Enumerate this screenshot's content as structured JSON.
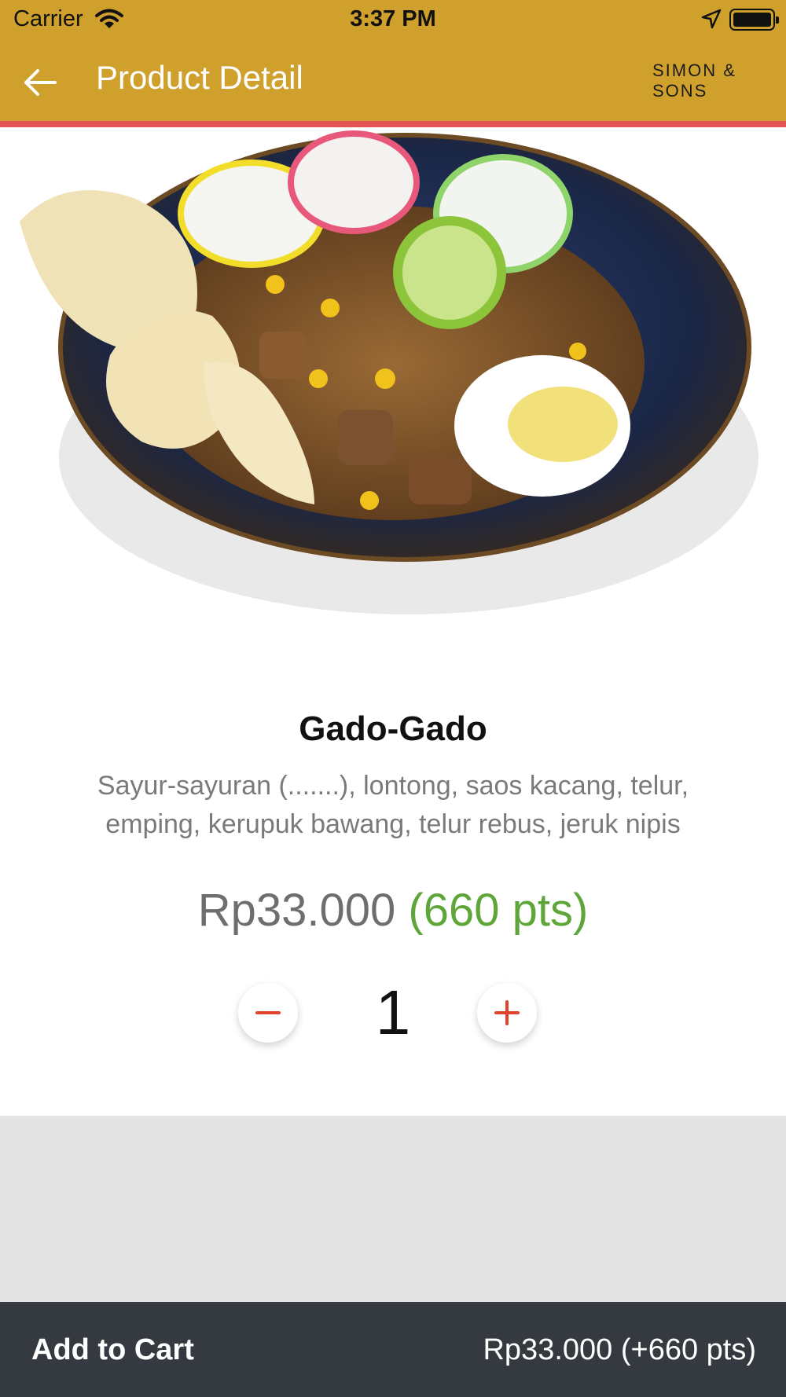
{
  "status_bar": {
    "carrier": "Carrier",
    "time": "3:37 PM",
    "icons": [
      "wifi-icon",
      "location-arrow-icon",
      "battery-icon"
    ]
  },
  "header": {
    "title": "Product Detail",
    "back_icon": "arrow-left-icon",
    "brand": "SIMON & SONS",
    "background_color": "#cfa02c",
    "accent_line_color": "#e35255"
  },
  "product": {
    "image": "gado-gado-bowl-photo",
    "name": "Gado-Gado",
    "description": "Sayur-sayuran (.......), lontong, saos kacang, telur, emping, kerupuk bawang, telur rebus, jeruk nipis",
    "price": "Rp33.000",
    "points": "(660 pts)",
    "price_color": "#6e6e6e",
    "points_color": "#5ea63a"
  },
  "quantity": {
    "value": "1",
    "decrement_icon": "minus-icon",
    "increment_icon": "plus-icon",
    "control_color": "#e2432b"
  },
  "cart_bar": {
    "label": "Add to Cart",
    "total": "Rp33.000 (+660 pts)",
    "background_color": "#343a3f"
  }
}
